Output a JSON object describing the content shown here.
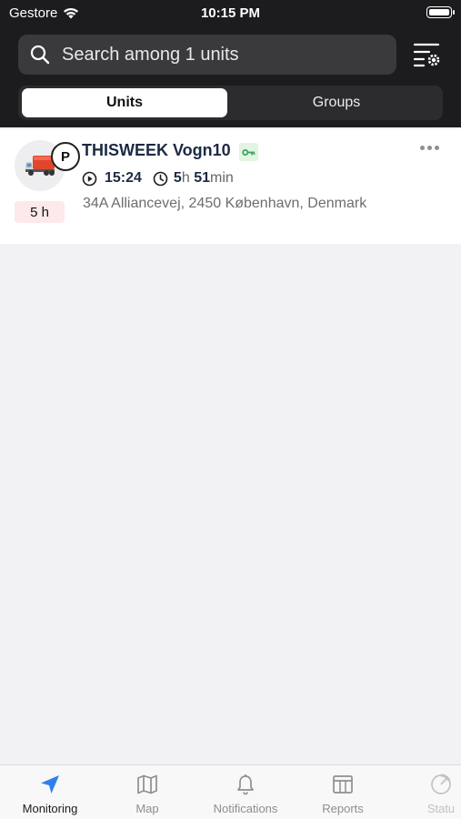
{
  "status_bar": {
    "carrier": "Gestore",
    "time": "10:15 PM"
  },
  "search": {
    "placeholder": "Search among 1 units"
  },
  "segments": {
    "units": "Units",
    "groups": "Groups",
    "selected": "Units"
  },
  "unit": {
    "name": "THISWEEK Vogn10",
    "state_badge": "P",
    "age_badge": "5 h",
    "time": "15:24",
    "duration_h": "5",
    "duration_h_unit": "h",
    "duration_min": "51",
    "duration_min_unit": "min",
    "address": "34A Alliancevej, 2450 København, Denmark"
  },
  "tabbar": {
    "items": [
      {
        "label": "Monitoring",
        "icon": "navigation-arrow-icon",
        "active": true
      },
      {
        "label": "Map",
        "icon": "map-icon",
        "active": false
      },
      {
        "label": "Notifications",
        "icon": "bell-icon",
        "active": false
      },
      {
        "label": "Reports",
        "icon": "table-icon",
        "active": false
      },
      {
        "label": "Statu",
        "icon": "status-dial-icon",
        "active": false
      }
    ]
  },
  "colors": {
    "header_bg": "#1c1c1e",
    "accent": "#2f80ed",
    "age_badge_bg": "#fde9ea",
    "key_green": "#3ba55c"
  }
}
